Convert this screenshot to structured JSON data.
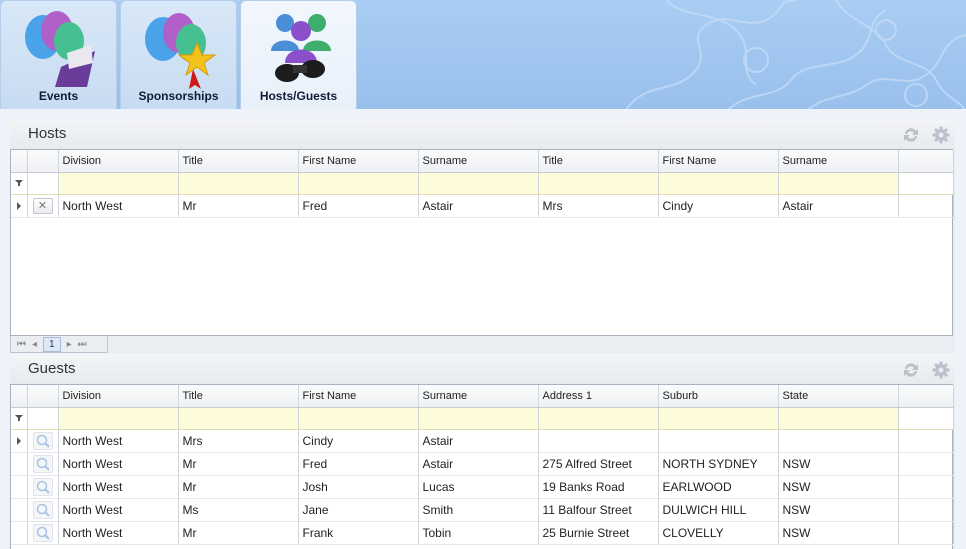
{
  "tabs": [
    {
      "label": "Events",
      "icon": "balloons-envelope-icon",
      "active": false
    },
    {
      "label": "Sponsorships",
      "icon": "balloons-ribbon-icon",
      "active": false
    },
    {
      "label": "Hosts/Guests",
      "icon": "people-binoculars-icon",
      "active": true
    }
  ],
  "hosts": {
    "title": "Hosts",
    "columns": [
      "Division",
      "Title",
      "First Name",
      "Surname",
      "Title",
      "First Name",
      "Surname"
    ],
    "rows": [
      {
        "division": "North West",
        "title": "Mr",
        "first_name": "Fred",
        "surname": "Astair",
        "title2": "Mrs",
        "first_name2": "Cindy",
        "surname2": "Astair"
      }
    ],
    "pager": {
      "current_page": "1"
    }
  },
  "guests": {
    "title": "Guests",
    "columns": [
      "Division",
      "Title",
      "First Name",
      "Surname",
      "Address 1",
      "Suburb",
      "State"
    ],
    "rows": [
      {
        "division": "North West",
        "title": "Mrs",
        "first_name": "Cindy",
        "surname": "Astair",
        "address1": "",
        "suburb": "",
        "state": ""
      },
      {
        "division": "North West",
        "title": "Mr",
        "first_name": "Fred",
        "surname": "Astair",
        "address1": "275 Alfred Street",
        "suburb": "NORTH SYDNEY",
        "state": "NSW"
      },
      {
        "division": "North West",
        "title": "Mr",
        "first_name": "Josh",
        "surname": "Lucas",
        "address1": "19 Banks Road",
        "suburb": "EARLWOOD",
        "state": "NSW"
      },
      {
        "division": "North West",
        "title": "Ms",
        "first_name": "Jane",
        "surname": "Smith",
        "address1": "11 Balfour Street",
        "suburb": "DULWICH HILL",
        "state": "NSW"
      },
      {
        "division": "North West",
        "title": "Mr",
        "first_name": "Frank",
        "surname": "Tobin",
        "address1": "25 Burnie Street",
        "suburb": "CLOVELLY",
        "state": "NSW"
      }
    ]
  },
  "colors": {
    "accent": "#9ec4ee",
    "filter_row": "#fefbd9",
    "tab_text": "#0f1d33"
  }
}
